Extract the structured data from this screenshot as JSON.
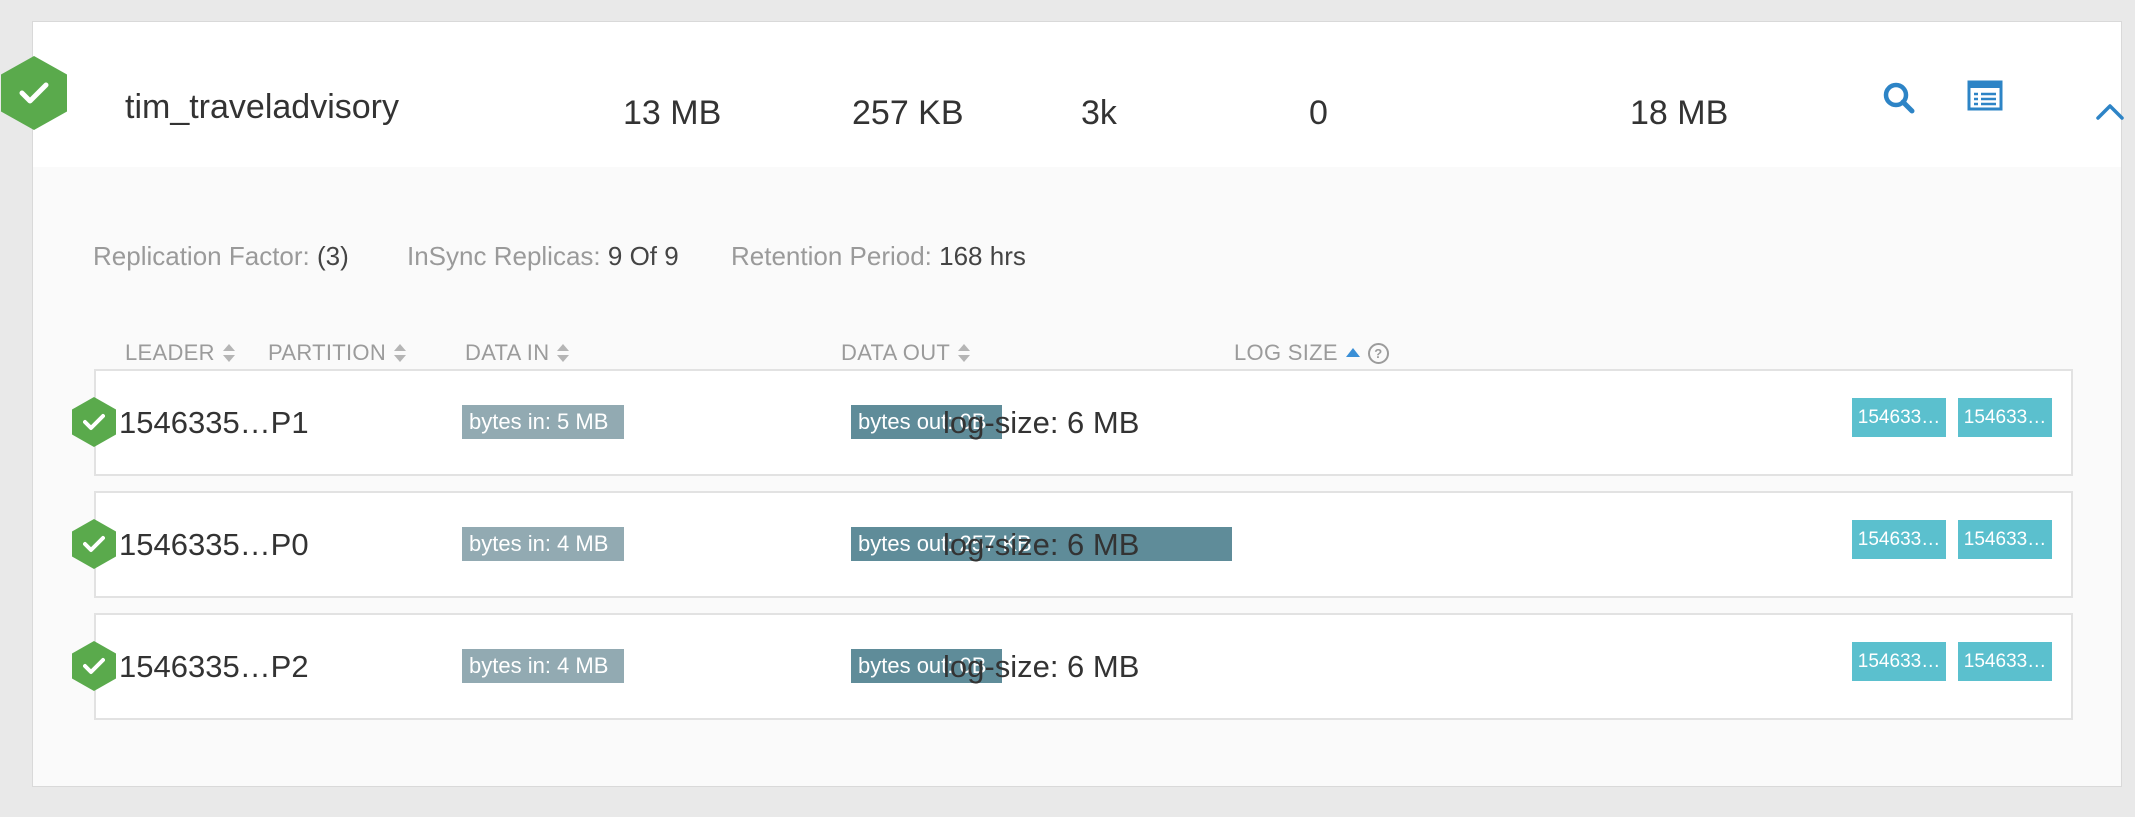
{
  "topic": {
    "name": "tim_traveladvisory",
    "metrics": [
      "13 MB",
      "257 KB",
      "3k",
      "0",
      "18 MB"
    ],
    "status_icon": "check-hexagon-icon",
    "actions": [
      "search-icon",
      "list-icon",
      "chevron-up-icon"
    ],
    "accent_color": "#3a8fd6",
    "status_color": "#5aaa4c"
  },
  "meta": {
    "replication_label": "Replication Factor:",
    "replication_value": "(3)",
    "insync_label": "InSync Replicas:",
    "insync_value": "9 Of 9",
    "retention_label": "Retention Period:",
    "retention_value": "168 hrs"
  },
  "columns": {
    "leader": "LEADER",
    "partition": "PARTITION",
    "data_in": "DATA IN",
    "data_out": "DATA OUT",
    "log_size": "LOG SIZE"
  },
  "rows": [
    {
      "leader": "1546335…P1",
      "bytes_in": "bytes in: 5 MB",
      "bytes_out": "bytes out: 0B",
      "log_size": "log-size: 6 MB",
      "replicas": [
        "154633…",
        "154633…"
      ]
    },
    {
      "leader": "1546335…P0",
      "bytes_in": "bytes in: 4 MB",
      "bytes_out": "bytes out: 257 KB",
      "log_size": "log-size: 6 MB",
      "replicas": [
        "154633…",
        "154633…"
      ]
    },
    {
      "leader": "1546335…P2",
      "bytes_in": "bytes in: 4 MB",
      "bytes_out": "bytes out: 0B",
      "log_size": "log-size: 6 MB",
      "replicas": [
        "154633…",
        "154633…"
      ]
    }
  ]
}
